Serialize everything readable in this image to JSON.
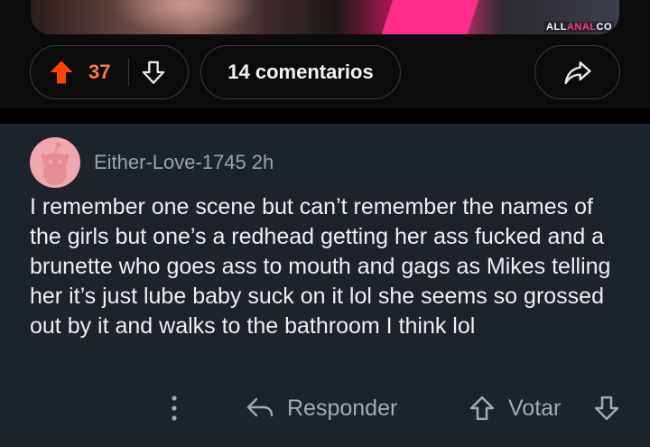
{
  "post": {
    "watermark": {
      "part1": "ALL",
      "part2": "ANAL",
      "part3": "CO"
    },
    "votes": {
      "count": "37"
    },
    "comments_label": "14 comentarios",
    "share_icon": "share-arrow-icon"
  },
  "comment": {
    "author": "Either-Love-1745",
    "time": "2h",
    "body": "I remember one scene but can’t remember the names of the girls but one’s a redhead getting her ass fucked and a brunette who goes ass to mouth and gags as Mikes telling her it’s just lube baby suck on it lol she seems so grossed out by it and walks to the bathroom I think lol",
    "actions": {
      "more_icon": "more-vertical-icon",
      "reply_label": "Responder",
      "vote_label": "Votar"
    }
  },
  "colors": {
    "upvote_active": "#ff4500",
    "vote_count": "#ff7a3d",
    "card_background": "#1d232a",
    "muted_text": "#a3abb3",
    "avatar_background": "#f1a7ad"
  }
}
